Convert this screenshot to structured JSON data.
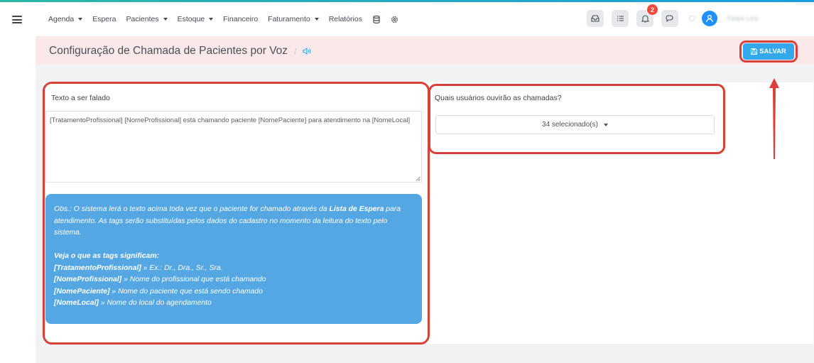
{
  "nav": {
    "items": [
      {
        "label": "Agenda",
        "dropdown": true
      },
      {
        "label": "Espera",
        "dropdown": false
      },
      {
        "label": "Pacientes",
        "dropdown": true
      },
      {
        "label": "Estoque",
        "dropdown": true
      },
      {
        "label": "Financeiro",
        "dropdown": false
      },
      {
        "label": "Faturamento",
        "dropdown": true
      },
      {
        "label": "Relatórios",
        "dropdown": false
      }
    ],
    "icons": [
      "database-icon",
      "settings-icon"
    ],
    "notification_count": "2",
    "username": "Felipe Lins"
  },
  "page": {
    "title": "Configuração de Chamada de Pacientes por Voz",
    "separator": "/",
    "save_label": "SALVAR"
  },
  "form": {
    "text_label": "Texto a ser falado",
    "text_value": "[TratamentoProfissional] [NomeProfissional] está chamando paciente [NomePaciente] para atendimento na [NomeLocal]",
    "users_label": "Quais usuários ouvirão as chamadas?",
    "users_selected": "34 selecionado(s)"
  },
  "info": {
    "obs_prefix": "Obs.: O sistema lerá o texto acima toda vez que o paciente for chamado através da ",
    "obs_link": "Lista de Espera",
    "obs_suffix": " para atendimento. As tags serão substituídas pelos dados do cadastro no momento da leitura do texto pelo sistema.",
    "tags_heading": "Veja o que as tags significam:",
    "tags": [
      {
        "tag": "[TratamentoProfissional]",
        "desc": " » Ex.: Dr., Dra., Sr., Sra."
      },
      {
        "tag": "[NomeProfissional]",
        "desc": " » Nome do profissional que está chamando"
      },
      {
        "tag": "[NomePaciente]",
        "desc": " » Nome do paciente que está sendo chamado"
      },
      {
        "tag": "[NomeLocal]",
        "desc": " » Nome do local do agendamento"
      }
    ]
  },
  "colors": {
    "accent": "#34a8ec",
    "highlight": "#d8413a",
    "info_bg": "#55a7e4",
    "title_bg": "#fbe9ea",
    "badge": "#ef4a3d"
  }
}
